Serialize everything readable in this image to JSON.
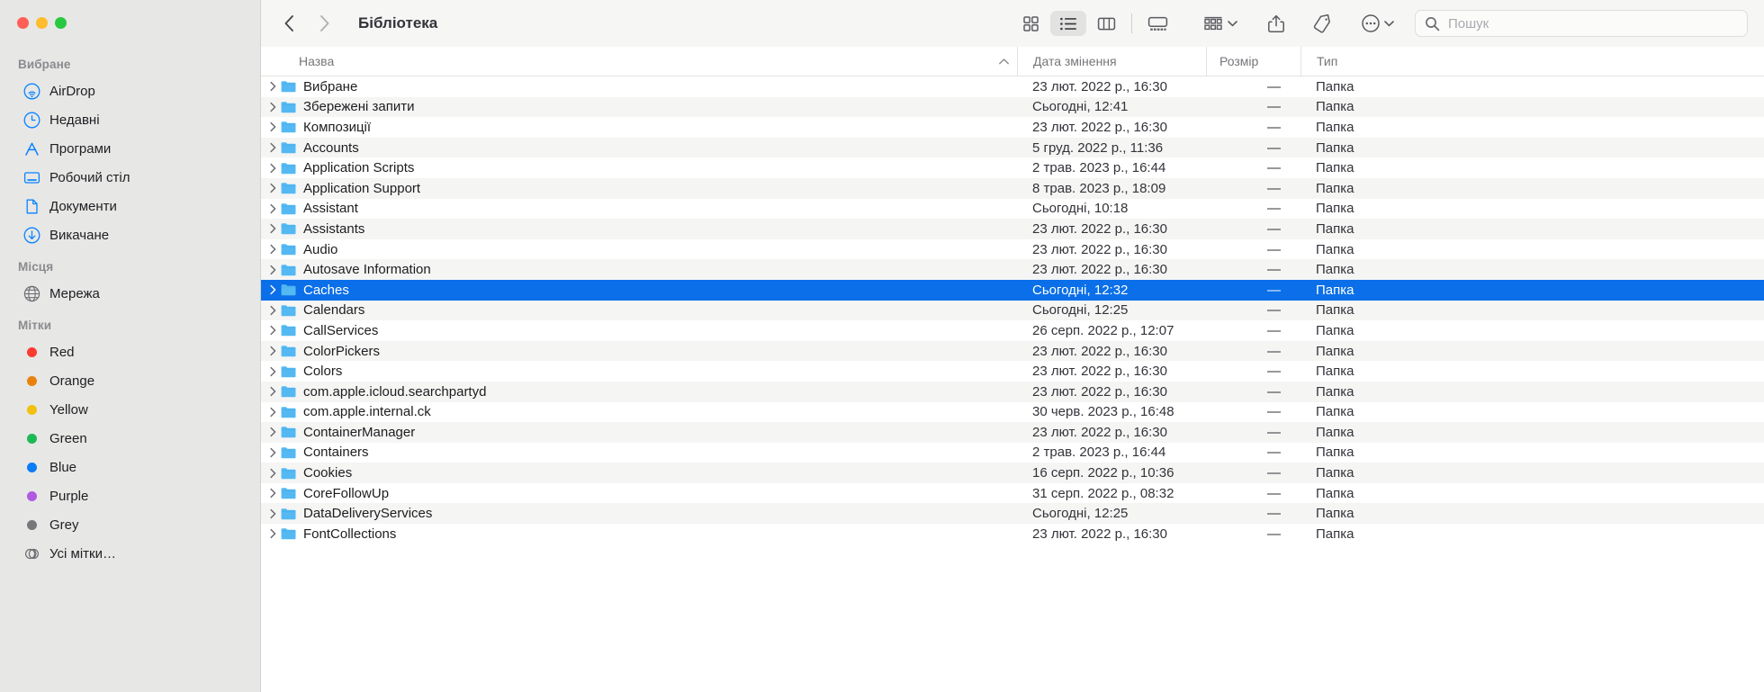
{
  "window": {
    "title": "Бібліотека",
    "traffic_lights": [
      "close",
      "minimize",
      "zoom"
    ]
  },
  "colors": {
    "selection_blue": "#0a6fe8",
    "sidebar_bg": "#e7e7e6",
    "folder_blue": "#54b9f2",
    "accent_icon": "#0a84ff"
  },
  "toolbar": {
    "back_label": "Назад",
    "forward_label": "Вперед",
    "view_icon_grid": "grid-view-icon",
    "view_icon_list": "list-view-icon",
    "view_icon_column": "column-view-icon",
    "view_icon_gallery": "gallery-view-icon",
    "active_view": "list",
    "group_icon": "group-by-icon",
    "share_icon": "share-icon",
    "tag_icon": "tag-icon",
    "more_icon": "more-actions-icon"
  },
  "search": {
    "placeholder": "Пошук",
    "value": "",
    "icon": "search-icon"
  },
  "sidebar": {
    "sections": [
      {
        "title": "Вибране",
        "items": [
          {
            "label": "AirDrop",
            "icon": "airdrop-icon"
          },
          {
            "label": "Недавні",
            "icon": "clock-icon"
          },
          {
            "label": "Програми",
            "icon": "applications-icon"
          },
          {
            "label": "Робочий стіл",
            "icon": "desktop-icon"
          },
          {
            "label": "Документи",
            "icon": "document-icon"
          },
          {
            "label": "Викачане",
            "icon": "downloads-icon"
          }
        ]
      },
      {
        "title": "Місця",
        "items": [
          {
            "label": "Мережа",
            "icon": "network-globe-icon"
          }
        ]
      },
      {
        "title": "Мітки",
        "items": [
          {
            "label": "Red",
            "icon": "tag-dot-icon",
            "color": "#fc3b2f"
          },
          {
            "label": "Orange",
            "icon": "tag-dot-icon",
            "color": "#e8820c"
          },
          {
            "label": "Yellow",
            "icon": "tag-dot-icon",
            "color": "#f2c00e"
          },
          {
            "label": "Green",
            "icon": "tag-dot-icon",
            "color": "#1db954"
          },
          {
            "label": "Blue",
            "icon": "tag-dot-icon",
            "color": "#0a7cf5"
          },
          {
            "label": "Purple",
            "icon": "tag-dot-icon",
            "color": "#b05ae0"
          },
          {
            "label": "Grey",
            "icon": "tag-dot-icon",
            "color": "#77777b"
          },
          {
            "label": "Усі мітки…",
            "icon": "all-tags-icon",
            "color": ""
          }
        ]
      }
    ]
  },
  "file_list": {
    "columns": [
      "Назва",
      "Дата змінення",
      "Розмір",
      "Тип"
    ],
    "sort_column": "Назва",
    "sort_direction": "ascending",
    "sort_indicator": "chevron-up-icon",
    "selected_index": 10,
    "rows": [
      {
        "name": "Вибране",
        "date": "23 лют. 2022 р., 16:30",
        "size": "—",
        "type": "Папка"
      },
      {
        "name": "Збережені запити",
        "date": "Сьогодні, 12:41",
        "size": "—",
        "type": "Папка"
      },
      {
        "name": "Композиції",
        "date": "23 лют. 2022 р., 16:30",
        "size": "—",
        "type": "Папка"
      },
      {
        "name": "Accounts",
        "date": "5 груд. 2022 р., 11:36",
        "size": "—",
        "type": "Папка"
      },
      {
        "name": "Application Scripts",
        "date": "2 трав. 2023 р., 16:44",
        "size": "—",
        "type": "Папка"
      },
      {
        "name": "Application Support",
        "date": "8 трав. 2023 р., 18:09",
        "size": "—",
        "type": "Папка"
      },
      {
        "name": "Assistant",
        "date": "Сьогодні, 10:18",
        "size": "—",
        "type": "Папка"
      },
      {
        "name": "Assistants",
        "date": "23 лют. 2022 р., 16:30",
        "size": "—",
        "type": "Папка"
      },
      {
        "name": "Audio",
        "date": "23 лют. 2022 р., 16:30",
        "size": "—",
        "type": "Папка"
      },
      {
        "name": "Autosave Information",
        "date": "23 лют. 2022 р., 16:30",
        "size": "—",
        "type": "Папка"
      },
      {
        "name": "Caches",
        "date": "Сьогодні, 12:32",
        "size": "—",
        "type": "Папка"
      },
      {
        "name": "Calendars",
        "date": "Сьогодні, 12:25",
        "size": "—",
        "type": "Папка"
      },
      {
        "name": "CallServices",
        "date": "26 серп. 2022 р., 12:07",
        "size": "—",
        "type": "Папка"
      },
      {
        "name": "ColorPickers",
        "date": "23 лют. 2022 р., 16:30",
        "size": "—",
        "type": "Папка"
      },
      {
        "name": "Colors",
        "date": "23 лют. 2022 р., 16:30",
        "size": "—",
        "type": "Папка"
      },
      {
        "name": "com.apple.icloud.searchpartyd",
        "date": "23 лют. 2022 р., 16:30",
        "size": "—",
        "type": "Папка"
      },
      {
        "name": "com.apple.internal.ck",
        "date": "30 черв. 2023 р., 16:48",
        "size": "—",
        "type": "Папка"
      },
      {
        "name": "ContainerManager",
        "date": "23 лют. 2022 р., 16:30",
        "size": "—",
        "type": "Папка"
      },
      {
        "name": "Containers",
        "date": "2 трав. 2023 р., 16:44",
        "size": "—",
        "type": "Папка"
      },
      {
        "name": "Cookies",
        "date": "16 серп. 2022 р., 10:36",
        "size": "—",
        "type": "Папка"
      },
      {
        "name": "CoreFollowUp",
        "date": "31 серп. 2022 р., 08:32",
        "size": "—",
        "type": "Папка"
      },
      {
        "name": "DataDeliveryServices",
        "date": "Сьогодні, 12:25",
        "size": "—",
        "type": "Папка"
      },
      {
        "name": "FontCollections",
        "date": "23 лют. 2022 р., 16:30",
        "size": "—",
        "type": "Папка"
      }
    ]
  }
}
